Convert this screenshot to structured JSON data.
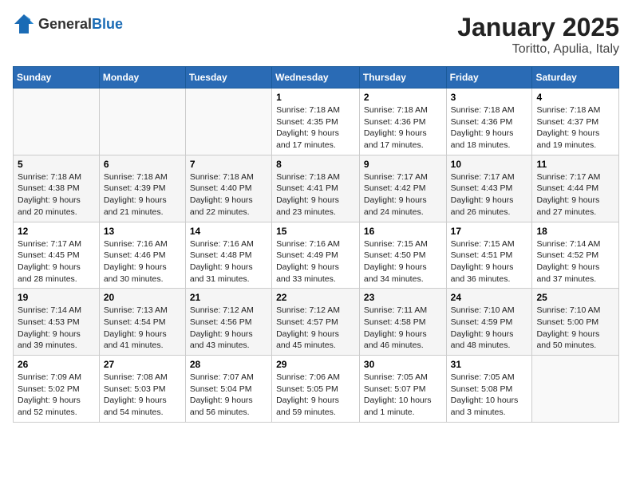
{
  "logo": {
    "general": "General",
    "blue": "Blue"
  },
  "title": "January 2025",
  "location": "Toritto, Apulia, Italy",
  "weekdays": [
    "Sunday",
    "Monday",
    "Tuesday",
    "Wednesday",
    "Thursday",
    "Friday",
    "Saturday"
  ],
  "weeks": [
    [
      {
        "day": "",
        "info": ""
      },
      {
        "day": "",
        "info": ""
      },
      {
        "day": "",
        "info": ""
      },
      {
        "day": "1",
        "info": "Sunrise: 7:18 AM\nSunset: 4:35 PM\nDaylight: 9 hours and 17 minutes."
      },
      {
        "day": "2",
        "info": "Sunrise: 7:18 AM\nSunset: 4:36 PM\nDaylight: 9 hours and 17 minutes."
      },
      {
        "day": "3",
        "info": "Sunrise: 7:18 AM\nSunset: 4:36 PM\nDaylight: 9 hours and 18 minutes."
      },
      {
        "day": "4",
        "info": "Sunrise: 7:18 AM\nSunset: 4:37 PM\nDaylight: 9 hours and 19 minutes."
      }
    ],
    [
      {
        "day": "5",
        "info": "Sunrise: 7:18 AM\nSunset: 4:38 PM\nDaylight: 9 hours and 20 minutes."
      },
      {
        "day": "6",
        "info": "Sunrise: 7:18 AM\nSunset: 4:39 PM\nDaylight: 9 hours and 21 minutes."
      },
      {
        "day": "7",
        "info": "Sunrise: 7:18 AM\nSunset: 4:40 PM\nDaylight: 9 hours and 22 minutes."
      },
      {
        "day": "8",
        "info": "Sunrise: 7:18 AM\nSunset: 4:41 PM\nDaylight: 9 hours and 23 minutes."
      },
      {
        "day": "9",
        "info": "Sunrise: 7:17 AM\nSunset: 4:42 PM\nDaylight: 9 hours and 24 minutes."
      },
      {
        "day": "10",
        "info": "Sunrise: 7:17 AM\nSunset: 4:43 PM\nDaylight: 9 hours and 26 minutes."
      },
      {
        "day": "11",
        "info": "Sunrise: 7:17 AM\nSunset: 4:44 PM\nDaylight: 9 hours and 27 minutes."
      }
    ],
    [
      {
        "day": "12",
        "info": "Sunrise: 7:17 AM\nSunset: 4:45 PM\nDaylight: 9 hours and 28 minutes."
      },
      {
        "day": "13",
        "info": "Sunrise: 7:16 AM\nSunset: 4:46 PM\nDaylight: 9 hours and 30 minutes."
      },
      {
        "day": "14",
        "info": "Sunrise: 7:16 AM\nSunset: 4:48 PM\nDaylight: 9 hours and 31 minutes."
      },
      {
        "day": "15",
        "info": "Sunrise: 7:16 AM\nSunset: 4:49 PM\nDaylight: 9 hours and 33 minutes."
      },
      {
        "day": "16",
        "info": "Sunrise: 7:15 AM\nSunset: 4:50 PM\nDaylight: 9 hours and 34 minutes."
      },
      {
        "day": "17",
        "info": "Sunrise: 7:15 AM\nSunset: 4:51 PM\nDaylight: 9 hours and 36 minutes."
      },
      {
        "day": "18",
        "info": "Sunrise: 7:14 AM\nSunset: 4:52 PM\nDaylight: 9 hours and 37 minutes."
      }
    ],
    [
      {
        "day": "19",
        "info": "Sunrise: 7:14 AM\nSunset: 4:53 PM\nDaylight: 9 hours and 39 minutes."
      },
      {
        "day": "20",
        "info": "Sunrise: 7:13 AM\nSunset: 4:54 PM\nDaylight: 9 hours and 41 minutes."
      },
      {
        "day": "21",
        "info": "Sunrise: 7:12 AM\nSunset: 4:56 PM\nDaylight: 9 hours and 43 minutes."
      },
      {
        "day": "22",
        "info": "Sunrise: 7:12 AM\nSunset: 4:57 PM\nDaylight: 9 hours and 45 minutes."
      },
      {
        "day": "23",
        "info": "Sunrise: 7:11 AM\nSunset: 4:58 PM\nDaylight: 9 hours and 46 minutes."
      },
      {
        "day": "24",
        "info": "Sunrise: 7:10 AM\nSunset: 4:59 PM\nDaylight: 9 hours and 48 minutes."
      },
      {
        "day": "25",
        "info": "Sunrise: 7:10 AM\nSunset: 5:00 PM\nDaylight: 9 hours and 50 minutes."
      }
    ],
    [
      {
        "day": "26",
        "info": "Sunrise: 7:09 AM\nSunset: 5:02 PM\nDaylight: 9 hours and 52 minutes."
      },
      {
        "day": "27",
        "info": "Sunrise: 7:08 AM\nSunset: 5:03 PM\nDaylight: 9 hours and 54 minutes."
      },
      {
        "day": "28",
        "info": "Sunrise: 7:07 AM\nSunset: 5:04 PM\nDaylight: 9 hours and 56 minutes."
      },
      {
        "day": "29",
        "info": "Sunrise: 7:06 AM\nSunset: 5:05 PM\nDaylight: 9 hours and 59 minutes."
      },
      {
        "day": "30",
        "info": "Sunrise: 7:05 AM\nSunset: 5:07 PM\nDaylight: 10 hours and 1 minute."
      },
      {
        "day": "31",
        "info": "Sunrise: 7:05 AM\nSunset: 5:08 PM\nDaylight: 10 hours and 3 minutes."
      },
      {
        "day": "",
        "info": ""
      }
    ]
  ]
}
